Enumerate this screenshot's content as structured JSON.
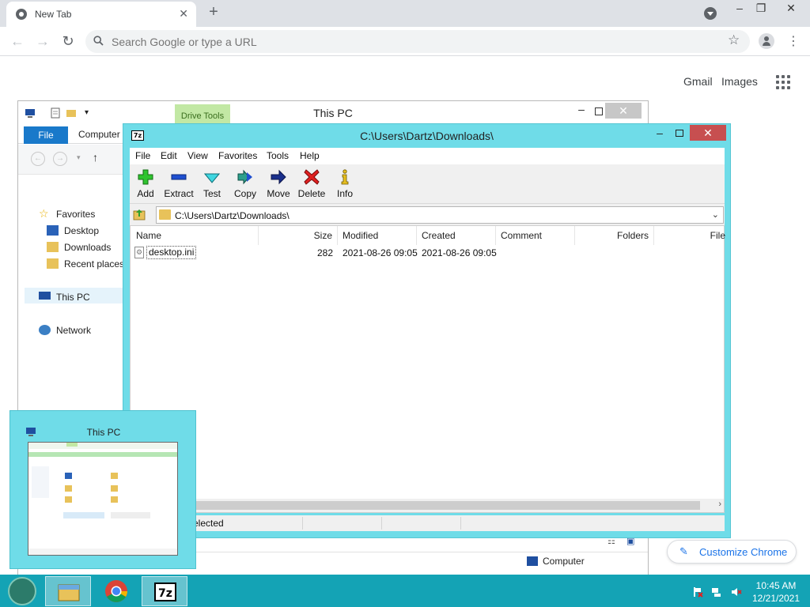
{
  "chrome": {
    "tab_title": "New Tab",
    "omnibox_placeholder": "Search Google or type a URL",
    "ntp_links": {
      "gmail": "Gmail",
      "images": "Images"
    },
    "customize_label": "Customize Chrome"
  },
  "explorer": {
    "title": "This PC",
    "contextual_tab": "Drive Tools",
    "ribbon_tabs": {
      "file": "File",
      "computer": "Computer"
    },
    "nav": {
      "favorites": "Favorites",
      "desktop": "Desktop",
      "downloads": "Downloads",
      "recent": "Recent places",
      "this_pc": "This PC",
      "network": "Network"
    },
    "status_computer": "Computer"
  },
  "sevenzip": {
    "title": "C:\\Users\\Dartz\\Downloads\\",
    "logo": "7z",
    "menu": [
      "File",
      "Edit",
      "View",
      "Favorites",
      "Tools",
      "Help"
    ],
    "tools": [
      {
        "label": "Add",
        "icon": "plus-icon"
      },
      {
        "label": "Extract",
        "icon": "minus-icon"
      },
      {
        "label": "Test",
        "icon": "check-icon"
      },
      {
        "label": "Copy",
        "icon": "double-arrow-icon"
      },
      {
        "label": "Move",
        "icon": "arrow-right-icon"
      },
      {
        "label": "Delete",
        "icon": "x-icon"
      },
      {
        "label": "Info",
        "icon": "info-icon"
      }
    ],
    "address": "C:\\Users\\Dartz\\Downloads\\",
    "columns": {
      "name": "Name",
      "size": "Size",
      "modified": "Modified",
      "created": "Created",
      "comment": "Comment",
      "folders": "Folders",
      "files": "File"
    },
    "rows": [
      {
        "name": "desktop.ini",
        "size": "282",
        "modified": "2021-08-26 09:05",
        "created": "2021-08-26 09:05"
      }
    ],
    "status_selected": "elected"
  },
  "thumbnail": {
    "title": "This PC"
  },
  "taskbar": {
    "time": "10:45 AM",
    "date": "12/21/2021"
  },
  "colors": {
    "sevenzip_frame": "#6fdce8",
    "taskbar": "#14a3b5",
    "chrome_accent": "#1a73e8",
    "file_tab": "#1979ca",
    "drive_tools": "#c2e8a4"
  }
}
